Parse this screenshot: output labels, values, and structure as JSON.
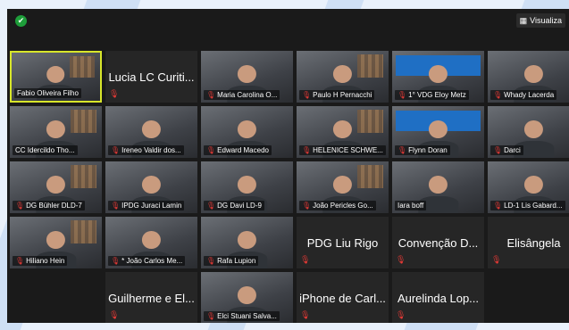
{
  "toolbar": {
    "view_label": "Visualiza",
    "security_icon": "shield-icon",
    "view_icon": "grid-icon"
  },
  "colors": {
    "active_speaker_border": "#d8e62a",
    "muted_mic": "#e53935",
    "tile_bg": "#262626",
    "window_bg": "#1a1a1a"
  },
  "participants": [
    {
      "name": "Fabio Oliveira Filho",
      "type": "video",
      "muted": false,
      "active": true
    },
    {
      "name": "Lucia LC Curiti...",
      "type": "name",
      "muted": true
    },
    {
      "name": "Maria Carolina O...",
      "type": "video",
      "muted": true
    },
    {
      "name": "Paulo H Pernacchi",
      "type": "video",
      "muted": true
    },
    {
      "name": "1° VDG Eloy Metz",
      "type": "video",
      "muted": true
    },
    {
      "name": "Whady Lacerda",
      "type": "video",
      "muted": true
    },
    {
      "name": "CC Idercildo Tho...",
      "type": "video",
      "muted": false
    },
    {
      "name": "Ireneo Valdir dos...",
      "type": "video",
      "muted": true
    },
    {
      "name": "Edward Macedo",
      "type": "video",
      "muted": true
    },
    {
      "name": "HELENICE SCHWE...",
      "type": "video",
      "muted": true
    },
    {
      "name": "Flynn Doran",
      "type": "video",
      "muted": true
    },
    {
      "name": "Darci",
      "type": "video",
      "muted": true
    },
    {
      "name": "DG Bühler DLD-7",
      "type": "video",
      "muted": true
    },
    {
      "name": "IPDG Juraci Lamin",
      "type": "video",
      "muted": true
    },
    {
      "name": "DG Davi LD-9",
      "type": "video",
      "muted": true
    },
    {
      "name": "João Pericles Go...",
      "type": "video",
      "muted": true
    },
    {
      "name": "Iara boff",
      "type": "video",
      "muted": false
    },
    {
      "name": "LD-1 Lis Gabard...",
      "type": "video",
      "muted": true
    },
    {
      "name": "Hiliano Hein",
      "type": "video",
      "muted": true
    },
    {
      "name": "* João Carlos Me...",
      "type": "video",
      "muted": true
    },
    {
      "name": "Rafa Lupion",
      "type": "video",
      "muted": true
    },
    {
      "name": "PDG Liu Rigo",
      "type": "name",
      "muted": true
    },
    {
      "name": "Convenção D...",
      "type": "name",
      "muted": true
    },
    {
      "name": "Elisângela",
      "type": "name",
      "muted": true
    },
    {
      "name": "Guilherme e El...",
      "type": "name",
      "muted": true
    },
    {
      "name": "Elci Stuani Salva...",
      "type": "video",
      "muted": true
    },
    {
      "name": "iPhone de Carl...",
      "type": "name",
      "muted": true
    },
    {
      "name": "Aurelinda Lop...",
      "type": "name",
      "muted": true
    }
  ]
}
